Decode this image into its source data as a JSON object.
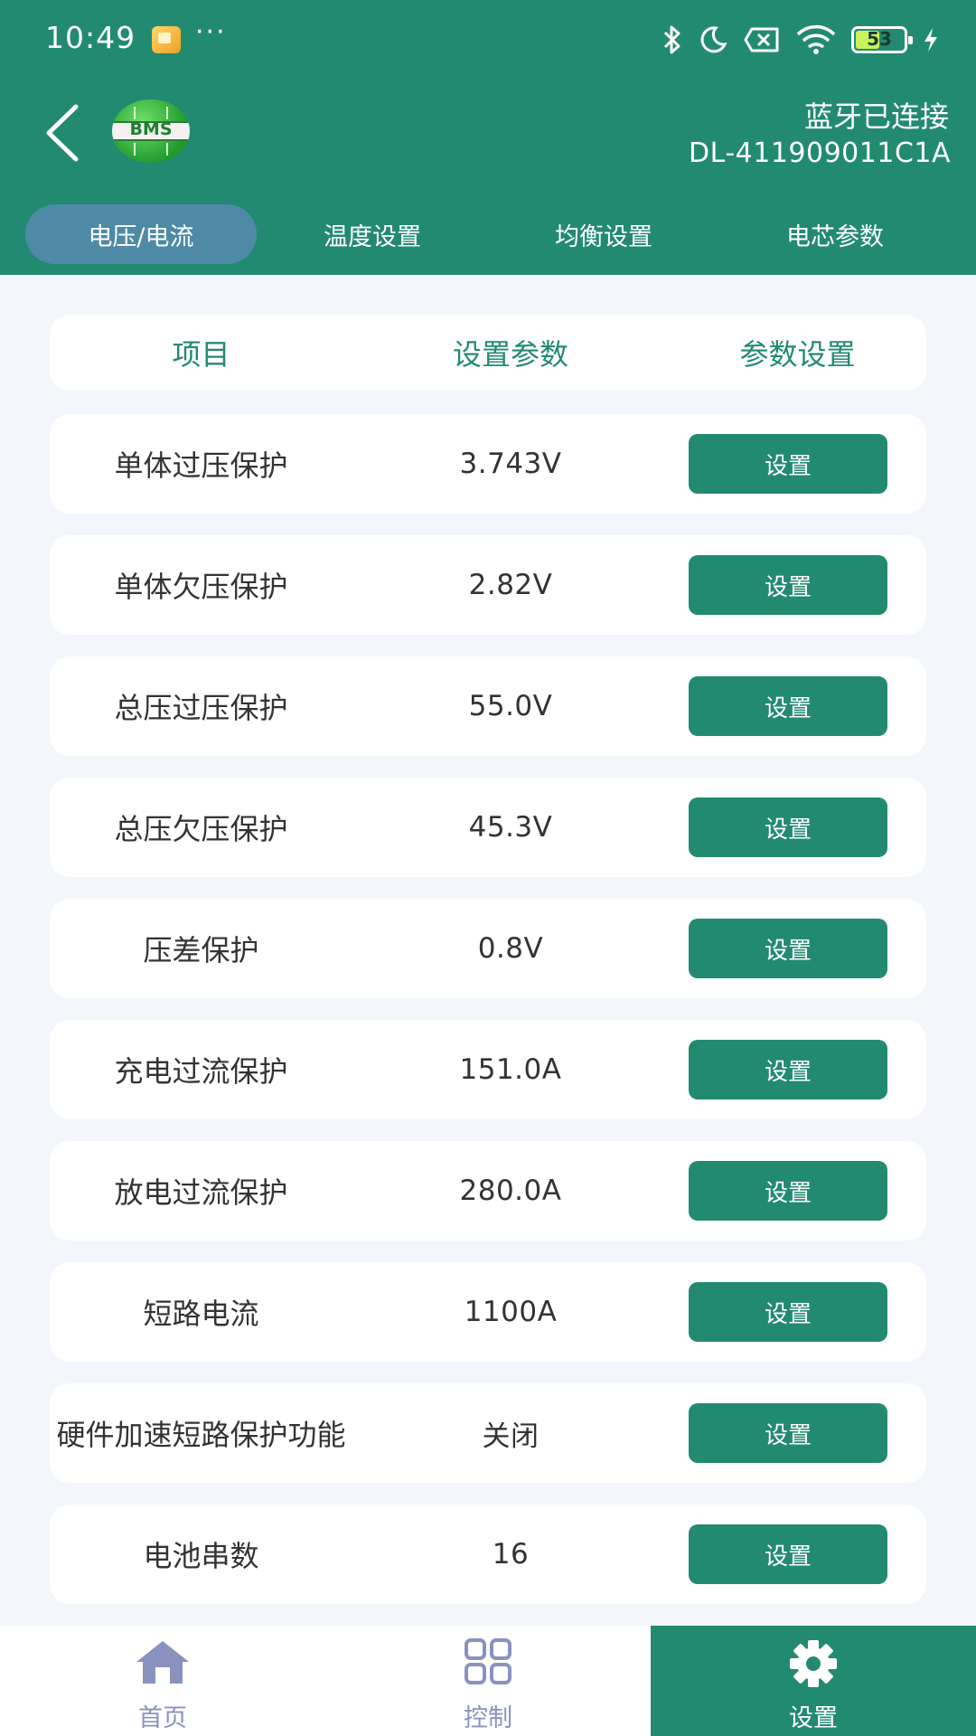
{
  "status_bar": {
    "time": "10:49",
    "dots": "···",
    "battery_level": "53",
    "icons": [
      "notification-app-icon",
      "bluetooth-icon",
      "moon-icon",
      "no-sim-icon",
      "wifi-icon",
      "battery-icon",
      "charging-icon"
    ]
  },
  "header": {
    "logo_text": "BMS",
    "connection_status": "蓝牙已连接",
    "device_id": "DL-411909011C1A"
  },
  "tabs": [
    {
      "label": "电压/电流",
      "active": true
    },
    {
      "label": "温度设置",
      "active": false
    },
    {
      "label": "均衡设置",
      "active": false
    },
    {
      "label": "电芯参数",
      "active": false
    }
  ],
  "table": {
    "headers": [
      "项目",
      "设置参数",
      "参数设置"
    ],
    "rows": [
      {
        "item": "单体过压保护",
        "value": "3.743V",
        "button": "设置"
      },
      {
        "item": "单体欠压保护",
        "value": "2.82V",
        "button": "设置"
      },
      {
        "item": "总压过压保护",
        "value": "55.0V",
        "button": "设置"
      },
      {
        "item": "总压欠压保护",
        "value": "45.3V",
        "button": "设置"
      },
      {
        "item": "压差保护",
        "value": "0.8V",
        "button": "设置"
      },
      {
        "item": "充电过流保护",
        "value": "151.0A",
        "button": "设置"
      },
      {
        "item": "放电过流保护",
        "value": "280.0A",
        "button": "设置"
      },
      {
        "item": "短路电流",
        "value": "1100A",
        "button": "设置"
      },
      {
        "item": "硬件加速短路保护功能",
        "value": "关闭",
        "button": "设置"
      },
      {
        "item": "电池串数",
        "value": "16",
        "button": "设置"
      }
    ]
  },
  "bottom_nav": [
    {
      "label": "首页",
      "icon": "home-icon",
      "active": false
    },
    {
      "label": "控制",
      "icon": "grid-icon",
      "active": false
    },
    {
      "label": "设置",
      "icon": "gear-icon",
      "active": true
    }
  ],
  "colors": {
    "primary": "#238a72",
    "active_tab": "#4e8aa6",
    "background": "#f3f6fb",
    "nav_inactive": "#8a92bf"
  }
}
